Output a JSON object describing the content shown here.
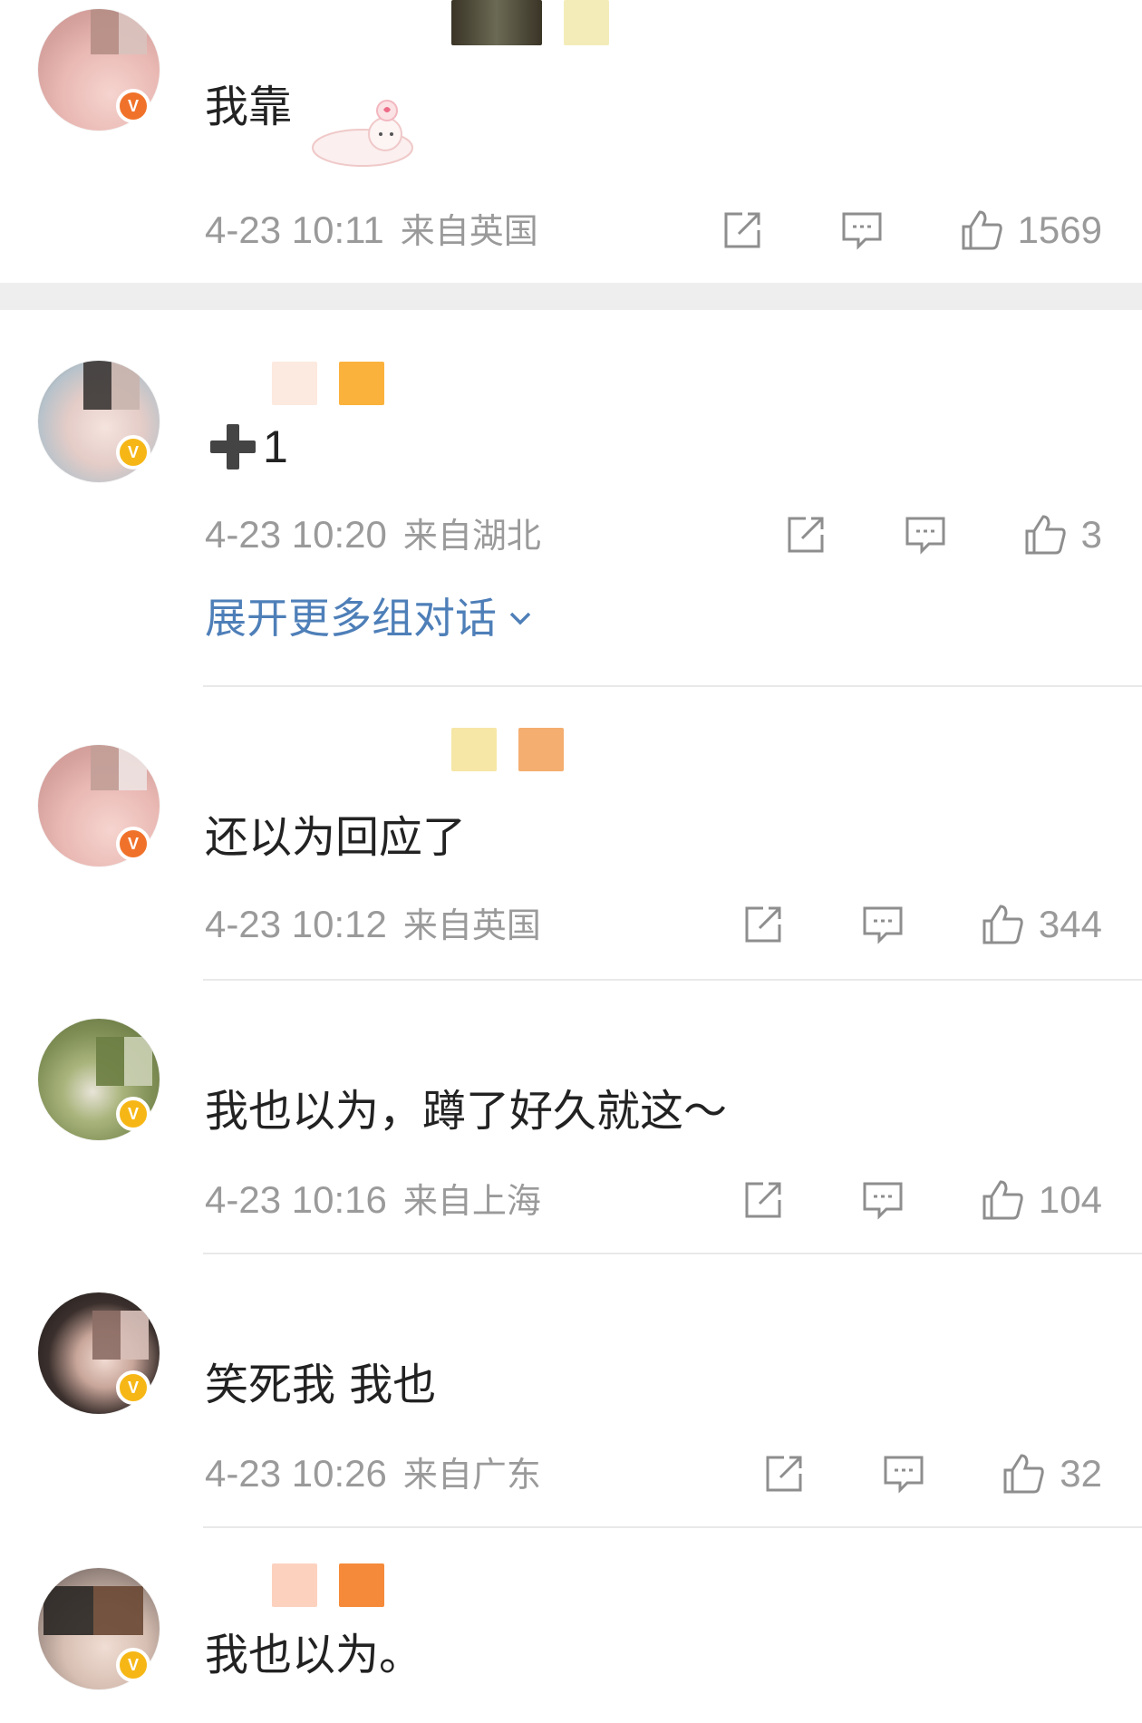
{
  "comments": [
    {
      "text": "我靠",
      "time": "4-23 10:11",
      "location": "来自英国",
      "likes": "1569",
      "badge_color": "#f0722a"
    },
    {
      "text": "1",
      "time": "4-23 10:20",
      "location": "来自湖北",
      "likes": "3",
      "badge_color": "#f6b716",
      "expand_label": "展开更多组对话"
    },
    {
      "text": "还以为回应了",
      "time": "4-23 10:12",
      "location": "来自英国",
      "likes": "344",
      "badge_color": "#f0722a"
    },
    {
      "text": "我也以为，蹲了好久就这～",
      "time": "4-23 10:16",
      "location": "来自上海",
      "likes": "104",
      "badge_color": "#f6b716"
    },
    {
      "text": "笑死我 我也",
      "time": "4-23 10:26",
      "location": "来自广东",
      "likes": "32",
      "badge_color": "#f6b716"
    },
    {
      "text": "我也以为。",
      "badge_color": "#f6b716"
    }
  ],
  "icons": {
    "repost": "share-icon",
    "comment": "comment-icon",
    "like": "thumbs-up-icon",
    "expand": "chevron-down-icon",
    "plus": "plus-emoji-icon"
  },
  "colors": {
    "meta_text": "#9a9a9a",
    "link_blue": "#4e7fb8",
    "section_gap": "#eeeeee"
  }
}
